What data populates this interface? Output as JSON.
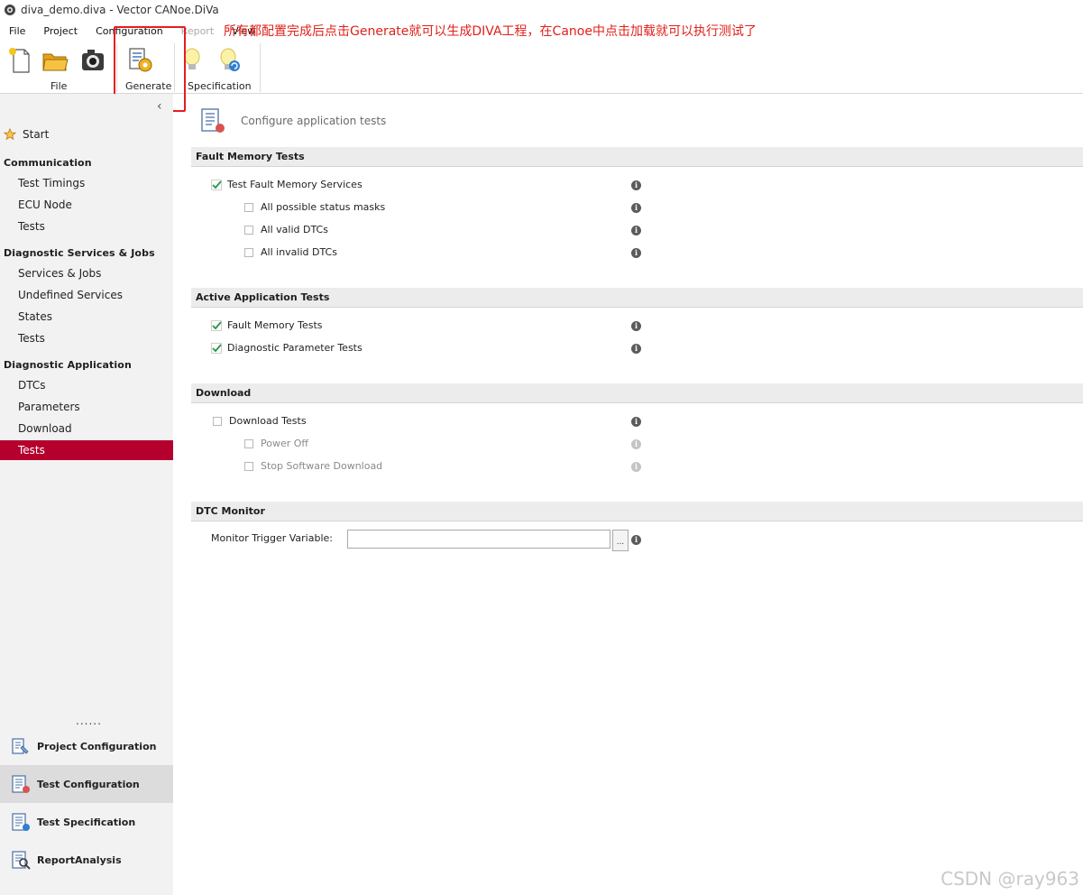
{
  "window": {
    "title": "diva_demo.diva - Vector CANoe.DiVa"
  },
  "menu": [
    {
      "label": "File",
      "disabled": false
    },
    {
      "label": "Project",
      "disabled": false
    },
    {
      "label": "Configuration",
      "disabled": false
    },
    {
      "label": "Report",
      "disabled": true
    },
    {
      "label": "View",
      "disabled": false
    }
  ],
  "annotation": "所有都配置完成后点击Generate就可以生成DIVA工程，在Canoe中点击加载就可以执行测试了",
  "ribbon": {
    "file_group_label": "File",
    "generate_label": "Generate",
    "specification_label": "Specification"
  },
  "sidebar": {
    "start": "Start",
    "sections": [
      {
        "title": "Communication",
        "items": [
          "Test Timings",
          "ECU Node",
          "Tests"
        ]
      },
      {
        "title": "Diagnostic Services & Jobs",
        "items": [
          "Services & Jobs",
          "Undefined Services",
          "States",
          "Tests"
        ]
      },
      {
        "title": "Diagnostic Application",
        "items": [
          "DTCs",
          "Parameters",
          "Download",
          "Tests"
        ]
      }
    ],
    "active_item": "Diagnostic Application / Tests",
    "dots": "......",
    "bottom": [
      "Project Configuration",
      "Test Configuration",
      "Test Specification",
      "ReportAnalysis"
    ],
    "bottom_active": "Test Configuration"
  },
  "main": {
    "header": "Configure application tests",
    "fault_memory": {
      "title": "Fault Memory Tests",
      "master": {
        "label": "Test Fault Memory Services",
        "checked": true
      },
      "options": [
        {
          "label": "All possible status masks",
          "checked": false
        },
        {
          "label": "All valid DTCs",
          "checked": false
        },
        {
          "label": "All invalid DTCs",
          "checked": false
        }
      ]
    },
    "active_app": {
      "title": "Active Application Tests",
      "items": [
        {
          "label": "Fault Memory Tests",
          "checked": true
        },
        {
          "label": "Diagnostic Parameter Tests",
          "checked": true
        }
      ]
    },
    "download": {
      "title": "Download",
      "master": {
        "label": "Download Tests",
        "checked": false
      },
      "options": [
        {
          "label": "Power Off",
          "checked": false,
          "disabled": true
        },
        {
          "label": "Stop Software Download",
          "checked": false,
          "disabled": true
        }
      ]
    },
    "dtc_monitor": {
      "title": "DTC Monitor",
      "label": "Monitor Trigger Variable:",
      "value": "",
      "browse": "..."
    }
  },
  "watermark": "CSDN @ray963",
  "colors": {
    "accent": "#b5002e",
    "annotation": "#e0201a",
    "check": "#1f9a4a"
  }
}
